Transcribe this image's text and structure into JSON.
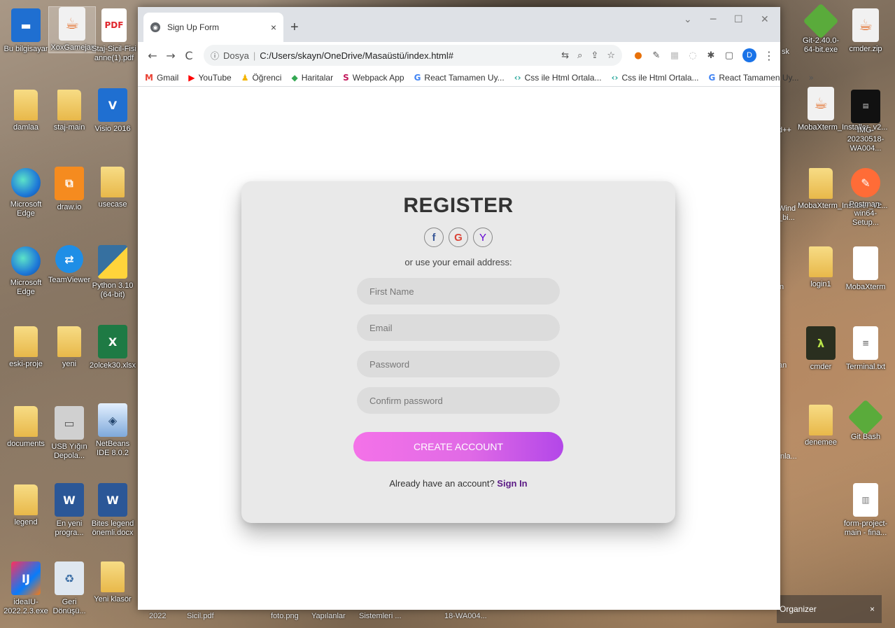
{
  "desktop": {
    "icons": [
      {
        "label": "Bu bilgisayar"
      },
      {
        "label": "XoxGamejar"
      },
      {
        "label": "Staj-Sicil-Fisi anne(1).pdf",
        "glyph": "PDF"
      },
      {
        "label": "damlaa"
      },
      {
        "label": "staj-main"
      },
      {
        "label": "Visio 2016",
        "glyph": "V"
      },
      {
        "label": "Microsoft Edge"
      },
      {
        "label": "draw.io"
      },
      {
        "label": "usecase"
      },
      {
        "label": "Microsoft Edge"
      },
      {
        "label": "TeamViewer",
        "glyph": "⇄"
      },
      {
        "label": "Python 3.10 (64-bit)"
      },
      {
        "label": "eski-proje"
      },
      {
        "label": "yeni"
      },
      {
        "label": "2olcek30.xlsx",
        "glyph": "X"
      },
      {
        "label": "documents"
      },
      {
        "label": "USB Yığın Depola..."
      },
      {
        "label": "NetBeans IDE 8.0.2"
      },
      {
        "label": "legend"
      },
      {
        "label": "En yeni progra...",
        "glyph": "W"
      },
      {
        "label": "Bites legend önemli.docx",
        "glyph": "W"
      },
      {
        "label": "ideaIU-2022.2.3.exe",
        "glyph": "IJ"
      },
      {
        "label": "Geri Dönüşü..."
      },
      {
        "label": "Yeni klasör"
      },
      {
        "label": "Git-2.40.0-64-bit.exe"
      },
      {
        "label": "cmder.zip"
      },
      {
        "label": "MobaXterm_Installer_v2..."
      },
      {
        "label": "IMG-20230518-WA004..."
      },
      {
        "label": "MobaXterm_Installer_v2..."
      },
      {
        "label": "Postman-win64-Setup..."
      },
      {
        "label": "login1"
      },
      {
        "label": "MobaXterm"
      },
      {
        "label": "cmder",
        "glyph": "λ"
      },
      {
        "label": "Terminal.txt"
      },
      {
        "label": "denemee"
      },
      {
        "label": "Git Bash"
      },
      {
        "label": "form-project-main - fina..."
      }
    ],
    "partial_labels": [
      "sk",
      "d++",
      "Wind",
      "_bi...",
      "n",
      "an",
      "nla..."
    ],
    "java_glyph": "☕",
    "organizer": {
      "label": "Organizer",
      "close": "×"
    },
    "bottom_strip": [
      "2022",
      "Sicil.pdf",
      "foto.png",
      "Yapılanlar",
      "Sistemleri ...",
      "18-WA004..."
    ]
  },
  "browser": {
    "tab": {
      "title": "Sign Up Form",
      "close": "×",
      "favicon": "◉"
    },
    "new_tab": "+",
    "window_controls": {
      "dropdown": "⌄",
      "minimize": "─",
      "maximize": "☐",
      "close": "✕"
    },
    "nav": {
      "back": "←",
      "forward": "→",
      "reload": "C"
    },
    "omnibox": {
      "info": "ⓘ",
      "scheme": "Dosya",
      "separator": "|",
      "url": "C:/Users/skayn/OneDrive/Masaüstü/index.html#"
    },
    "omnibox_icons": {
      "translate": "⇆",
      "zoom": "⌕",
      "share": "⇪",
      "star": "☆"
    },
    "extensions": [
      "●",
      "✎",
      "▦",
      "◌",
      "✱",
      "▢"
    ],
    "profile_initial": "D",
    "menu": "⋮",
    "bookmarks": [
      {
        "icon": "M",
        "label": "Gmail",
        "color": "#ea4335"
      },
      {
        "icon": "▶",
        "label": "YouTube",
        "color": "#ff0000"
      },
      {
        "icon": "♟",
        "label": "Öğrenci",
        "color": "#f4b400"
      },
      {
        "icon": "◆",
        "label": "Haritalar",
        "color": "#34a853"
      },
      {
        "icon": "S",
        "label": "Webpack App",
        "color": "#c2185b"
      },
      {
        "icon": "G",
        "label": "React Tamamen Uy...",
        "color": "#4285f4"
      },
      {
        "icon": "‹›",
        "label": "Css ile Html Ortala...",
        "color": "#26a69a"
      },
      {
        "icon": "‹›",
        "label": "Css ile Html Ortala...",
        "color": "#26a69a"
      },
      {
        "icon": "G",
        "label": "React Tamamen Uy...",
        "color": "#4285f4"
      }
    ],
    "bookmarks_more": "»"
  },
  "form": {
    "title": "REGISTER",
    "socials": [
      {
        "glyph": "f",
        "name": "facebook"
      },
      {
        "glyph": "G",
        "name": "google"
      },
      {
        "glyph": "Y",
        "name": "yahoo"
      }
    ],
    "subtitle": "or use your email address:",
    "fields": {
      "first_name": "First Name",
      "email": "Email",
      "password": "Password",
      "confirm_password": "Confirm password"
    },
    "submit_label": "CREATE ACCOUNT",
    "signin_prompt": "Already have an account?",
    "signin_link": "Sign In"
  },
  "colors": {
    "button_gradient_start": "#f472e8",
    "button_gradient_end": "#b347e8",
    "signin_link": "#5b1a85",
    "card_bg": "#e9e9e9"
  }
}
